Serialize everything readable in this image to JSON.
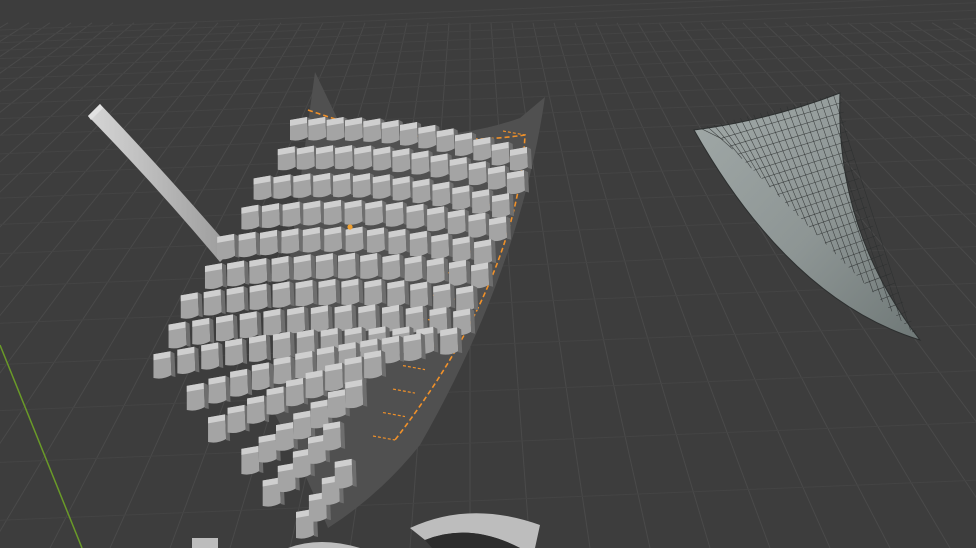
{
  "app": {
    "view": "3D Viewport",
    "mode": "object",
    "shading": "solid"
  },
  "colors": {
    "background": "#3d3d3d",
    "grid_line": "#4a4a4a",
    "grid_line_faint": "#444444",
    "y_axis": "#6a9a28",
    "selection_outline": "#f0912a",
    "origin_dot": "#f0a030",
    "surface_dark": "#505050",
    "tile_light": "#cfcfcf",
    "tile_mid": "#a4a4a4",
    "tile_dark": "#6e6e6e",
    "rod": "#b9b9b9",
    "cloth": "#8e9695",
    "cloth_wire": "#2c2f2f",
    "ring": "#bdbdbd"
  },
  "scene": {
    "objects": [
      {
        "name": "roof-tiles",
        "selected": true,
        "rows": 14,
        "cols": 13
      },
      {
        "name": "base-plane",
        "selected": true
      },
      {
        "name": "rod",
        "selected": false
      },
      {
        "name": "cloth-sheet",
        "selected": false,
        "wireframe": true
      },
      {
        "name": "ring",
        "selected": false
      }
    ]
  }
}
